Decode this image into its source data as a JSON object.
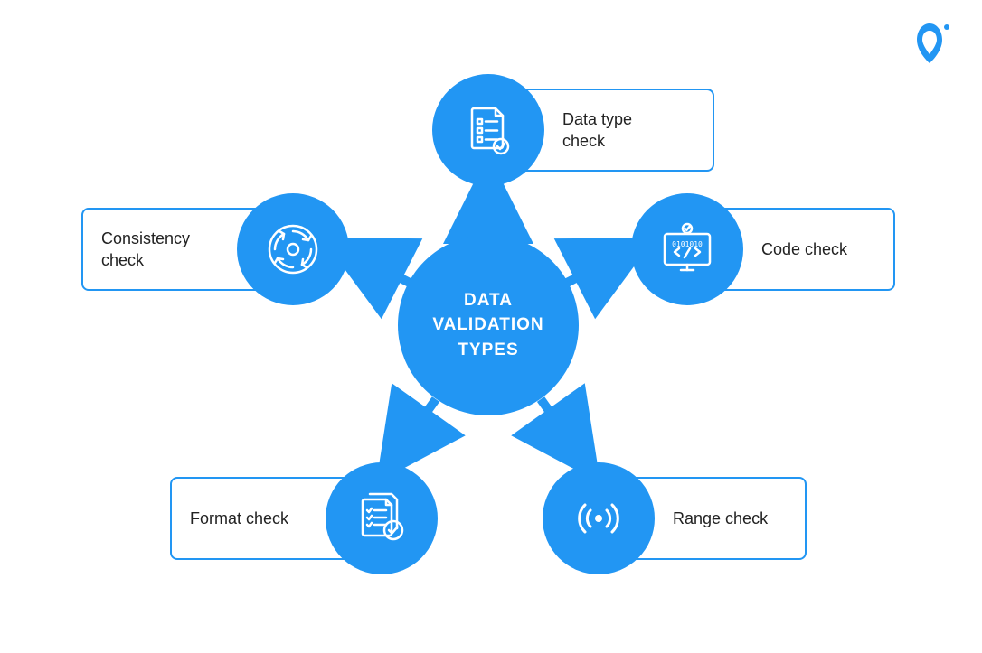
{
  "colors": {
    "primary": "#2296f3",
    "background": "#ffffff",
    "text": "#222222",
    "iconStroke": "#ffffff"
  },
  "center": {
    "title": "DATA\nVALIDATION\nTYPES"
  },
  "nodes": {
    "top": {
      "label": "Data type\ncheck",
      "icon": "checklist-doc-icon"
    },
    "right": {
      "label": "Code check",
      "icon": "code-monitor-icon"
    },
    "bottomRight": {
      "label": "Range check",
      "icon": "signal-range-icon"
    },
    "bottomLeft": {
      "label": "Format check",
      "icon": "document-approved-icon"
    },
    "left": {
      "label": "Consistency\ncheck",
      "icon": "refresh-cycle-icon"
    }
  },
  "logo": {
    "icon": "brand-a-icon"
  }
}
